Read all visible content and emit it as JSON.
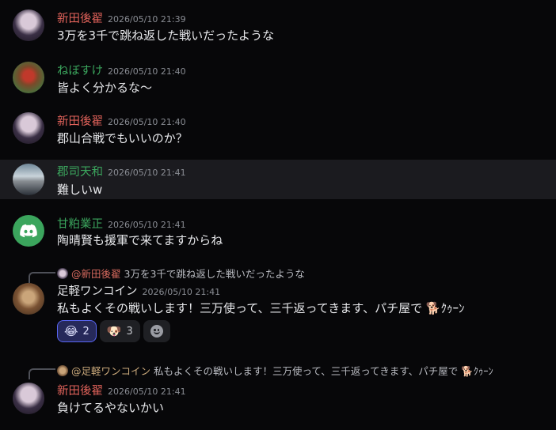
{
  "messages": [
    {
      "author": "新田後翟",
      "color": "#e0625a",
      "time": "2026/05/10 21:39",
      "text": "3万を3千で跳ね返した戦いだったような"
    },
    {
      "author": "ねぼすけ",
      "color": "#3ba55d",
      "time": "2026/05/10 21:40",
      "text": "皆よく分かるな～"
    },
    {
      "author": "新田後翟",
      "color": "#e0625a",
      "time": "2026/05/10 21:40",
      "text": "郡山合戦でもいいのか？"
    },
    {
      "author": "郡司天和",
      "color": "#3ba55d",
      "time": "2026/05/10 21:41",
      "text": "難しいw"
    },
    {
      "author": "甘粕業正",
      "color": "#3ba55d",
      "time": "2026/05/10 21:41",
      "text": "陶晴賢も援軍で来てますからね"
    },
    {
      "author": "足軽ワンコイン",
      "color": "#e6e7ea",
      "time": "2026/05/10 21:41",
      "text": "私もよくその戦いします！三万使って、三千返ってきます、パチ屋で 🐕ｸｩｰﾝ",
      "reply": {
        "name": "@新田後翟",
        "text": "3万を3千で跳ね返した戦いだったような"
      },
      "reactions": [
        {
          "emoji": "😂",
          "count": "2"
        },
        {
          "emoji": "🐶",
          "count": "3"
        }
      ]
    },
    {
      "author": "新田後翟",
      "color": "#e0625a",
      "time": "2026/05/10 21:41",
      "text": "負けてるやないかい",
      "reply": {
        "name": "@足軽ワンコイン",
        "text": "私もよくその戦いします！三万使って、三千返ってきます、パチ屋で 🐕ｸｩｰﾝ"
      }
    }
  ]
}
